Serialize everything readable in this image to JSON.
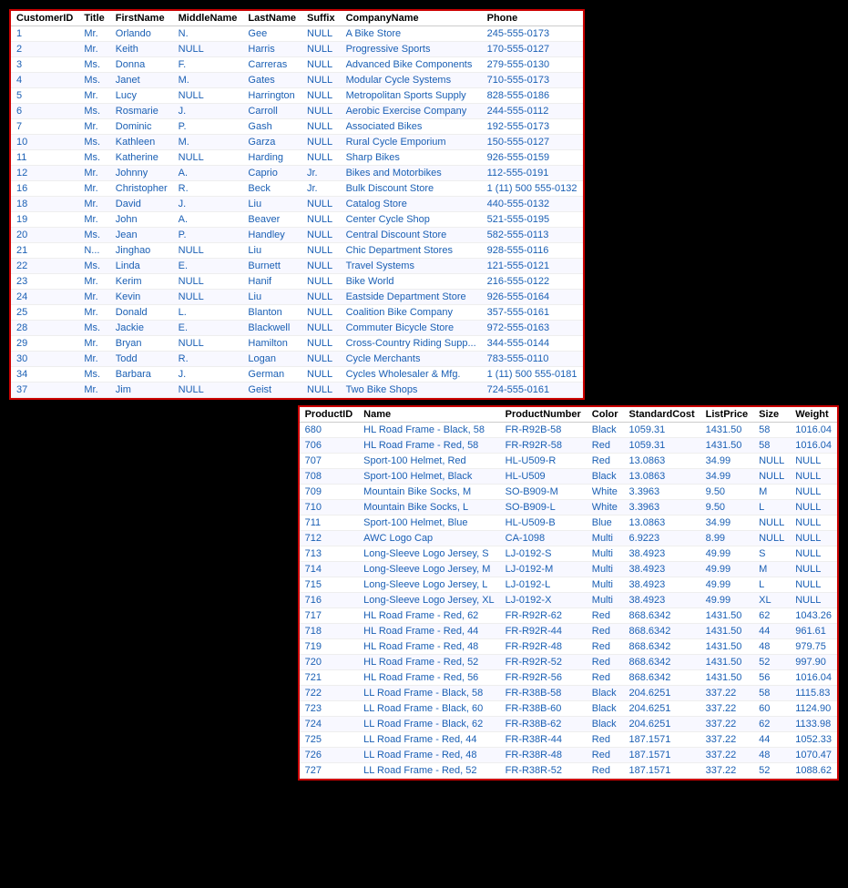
{
  "customers": {
    "columns": [
      "CustomerID",
      "Title",
      "FirstName",
      "MiddleName",
      "LastName",
      "Suffix",
      "CompanyName",
      "Phone"
    ],
    "rows": [
      [
        "1",
        "Mr.",
        "Orlando",
        "N.",
        "Gee",
        "NULL",
        "A Bike Store",
        "245-555-0173"
      ],
      [
        "2",
        "Mr.",
        "Keith",
        "NULL",
        "Harris",
        "NULL",
        "Progressive Sports",
        "170-555-0127"
      ],
      [
        "3",
        "Ms.",
        "Donna",
        "F.",
        "Carreras",
        "NULL",
        "Advanced Bike Components",
        "279-555-0130"
      ],
      [
        "4",
        "Ms.",
        "Janet",
        "M.",
        "Gates",
        "NULL",
        "Modular Cycle Systems",
        "710-555-0173"
      ],
      [
        "5",
        "Mr.",
        "Lucy",
        "NULL",
        "Harrington",
        "NULL",
        "Metropolitan Sports Supply",
        "828-555-0186"
      ],
      [
        "6",
        "Ms.",
        "Rosmarie",
        "J.",
        "Carroll",
        "NULL",
        "Aerobic Exercise Company",
        "244-555-0112"
      ],
      [
        "7",
        "Mr.",
        "Dominic",
        "P.",
        "Gash",
        "NULL",
        "Associated Bikes",
        "192-555-0173"
      ],
      [
        "10",
        "Ms.",
        "Kathleen",
        "M.",
        "Garza",
        "NULL",
        "Rural Cycle Emporium",
        "150-555-0127"
      ],
      [
        "11",
        "Ms.",
        "Katherine",
        "NULL",
        "Harding",
        "NULL",
        "Sharp Bikes",
        "926-555-0159"
      ],
      [
        "12",
        "Mr.",
        "Johnny",
        "A.",
        "Caprio",
        "Jr.",
        "Bikes and Motorbikes",
        "112-555-0191"
      ],
      [
        "16",
        "Mr.",
        "Christopher",
        "R.",
        "Beck",
        "Jr.",
        "Bulk Discount Store",
        "1 (11) 500 555-0132"
      ],
      [
        "18",
        "Mr.",
        "David",
        "J.",
        "Liu",
        "NULL",
        "Catalog Store",
        "440-555-0132"
      ],
      [
        "19",
        "Mr.",
        "John",
        "A.",
        "Beaver",
        "NULL",
        "Center Cycle Shop",
        "521-555-0195"
      ],
      [
        "20",
        "Ms.",
        "Jean",
        "P.",
        "Handley",
        "NULL",
        "Central Discount Store",
        "582-555-0113"
      ],
      [
        "21",
        "N...",
        "Jinghao",
        "NULL",
        "Liu",
        "NULL",
        "Chic Department Stores",
        "928-555-0116"
      ],
      [
        "22",
        "Ms.",
        "Linda",
        "E.",
        "Burnett",
        "NULL",
        "Travel Systems",
        "121-555-0121"
      ],
      [
        "23",
        "Mr.",
        "Kerim",
        "NULL",
        "Hanif",
        "NULL",
        "Bike World",
        "216-555-0122"
      ],
      [
        "24",
        "Mr.",
        "Kevin",
        "NULL",
        "Liu",
        "NULL",
        "Eastside Department Store",
        "926-555-0164"
      ],
      [
        "25",
        "Mr.",
        "Donald",
        "L.",
        "Blanton",
        "NULL",
        "Coalition Bike Company",
        "357-555-0161"
      ],
      [
        "28",
        "Ms.",
        "Jackie",
        "E.",
        "Blackwell",
        "NULL",
        "Commuter Bicycle Store",
        "972-555-0163"
      ],
      [
        "29",
        "Mr.",
        "Bryan",
        "NULL",
        "Hamilton",
        "NULL",
        "Cross-Country Riding Supp...",
        "344-555-0144"
      ],
      [
        "30",
        "Mr.",
        "Todd",
        "R.",
        "Logan",
        "NULL",
        "Cycle Merchants",
        "783-555-0110"
      ],
      [
        "34",
        "Ms.",
        "Barbara",
        "J.",
        "German",
        "NULL",
        "Cycles Wholesaler & Mfg.",
        "1 (11) 500 555-0181"
      ],
      [
        "37",
        "Mr.",
        "Jim",
        "NULL",
        "Geist",
        "NULL",
        "Two Bike Shops",
        "724-555-0161"
      ]
    ]
  },
  "products": {
    "columns": [
      "ProductID",
      "Name",
      "ProductNumber",
      "Color",
      "StandardCost",
      "ListPrice",
      "Size",
      "Weight"
    ],
    "rows": [
      [
        "680",
        "HL Road Frame - Black, 58",
        "FR-R92B-58",
        "Black",
        "1059.31",
        "1431.50",
        "58",
        "1016.04"
      ],
      [
        "706",
        "HL Road Frame - Red, 58",
        "FR-R92R-58",
        "Red",
        "1059.31",
        "1431.50",
        "58",
        "1016.04"
      ],
      [
        "707",
        "Sport-100 Helmet, Red",
        "HL-U509-R",
        "Red",
        "13.0863",
        "34.99",
        "NULL",
        "NULL"
      ],
      [
        "708",
        "Sport-100 Helmet, Black",
        "HL-U509",
        "Black",
        "13.0863",
        "34.99",
        "NULL",
        "NULL"
      ],
      [
        "709",
        "Mountain Bike Socks, M",
        "SO-B909-M",
        "White",
        "3.3963",
        "9.50",
        "M",
        "NULL"
      ],
      [
        "710",
        "Mountain Bike Socks, L",
        "SO-B909-L",
        "White",
        "3.3963",
        "9.50",
        "L",
        "NULL"
      ],
      [
        "711",
        "Sport-100 Helmet, Blue",
        "HL-U509-B",
        "Blue",
        "13.0863",
        "34.99",
        "NULL",
        "NULL"
      ],
      [
        "712",
        "AWC Logo Cap",
        "CA-1098",
        "Multi",
        "6.9223",
        "8.99",
        "NULL",
        "NULL"
      ],
      [
        "713",
        "Long-Sleeve Logo Jersey, S",
        "LJ-0192-S",
        "Multi",
        "38.4923",
        "49.99",
        "S",
        "NULL"
      ],
      [
        "714",
        "Long-Sleeve Logo Jersey, M",
        "LJ-0192-M",
        "Multi",
        "38.4923",
        "49.99",
        "M",
        "NULL"
      ],
      [
        "715",
        "Long-Sleeve Logo Jersey, L",
        "LJ-0192-L",
        "Multi",
        "38.4923",
        "49.99",
        "L",
        "NULL"
      ],
      [
        "716",
        "Long-Sleeve Logo Jersey, XL",
        "LJ-0192-X",
        "Multi",
        "38.4923",
        "49.99",
        "XL",
        "NULL"
      ],
      [
        "717",
        "HL Road Frame - Red, 62",
        "FR-R92R-62",
        "Red",
        "868.6342",
        "1431.50",
        "62",
        "1043.26"
      ],
      [
        "718",
        "HL Road Frame - Red, 44",
        "FR-R92R-44",
        "Red",
        "868.6342",
        "1431.50",
        "44",
        "961.61"
      ],
      [
        "719",
        "HL Road Frame - Red, 48",
        "FR-R92R-48",
        "Red",
        "868.6342",
        "1431.50",
        "48",
        "979.75"
      ],
      [
        "720",
        "HL Road Frame - Red, 52",
        "FR-R92R-52",
        "Red",
        "868.6342",
        "1431.50",
        "52",
        "997.90"
      ],
      [
        "721",
        "HL Road Frame - Red, 56",
        "FR-R92R-56",
        "Red",
        "868.6342",
        "1431.50",
        "56",
        "1016.04"
      ],
      [
        "722",
        "LL Road Frame - Black, 58",
        "FR-R38B-58",
        "Black",
        "204.6251",
        "337.22",
        "58",
        "1115.83"
      ],
      [
        "723",
        "LL Road Frame - Black, 60",
        "FR-R38B-60",
        "Black",
        "204.6251",
        "337.22",
        "60",
        "1124.90"
      ],
      [
        "724",
        "LL Road Frame - Black, 62",
        "FR-R38B-62",
        "Black",
        "204.6251",
        "337.22",
        "62",
        "1133.98"
      ],
      [
        "725",
        "LL Road Frame - Red, 44",
        "FR-R38R-44",
        "Red",
        "187.1571",
        "337.22",
        "44",
        "1052.33"
      ],
      [
        "726",
        "LL Road Frame - Red, 48",
        "FR-R38R-48",
        "Red",
        "187.1571",
        "337.22",
        "48",
        "1070.47"
      ],
      [
        "727",
        "LL Road Frame - Red, 52",
        "FR-R38R-52",
        "Red",
        "187.1571",
        "337.22",
        "52",
        "1088.62"
      ]
    ]
  }
}
